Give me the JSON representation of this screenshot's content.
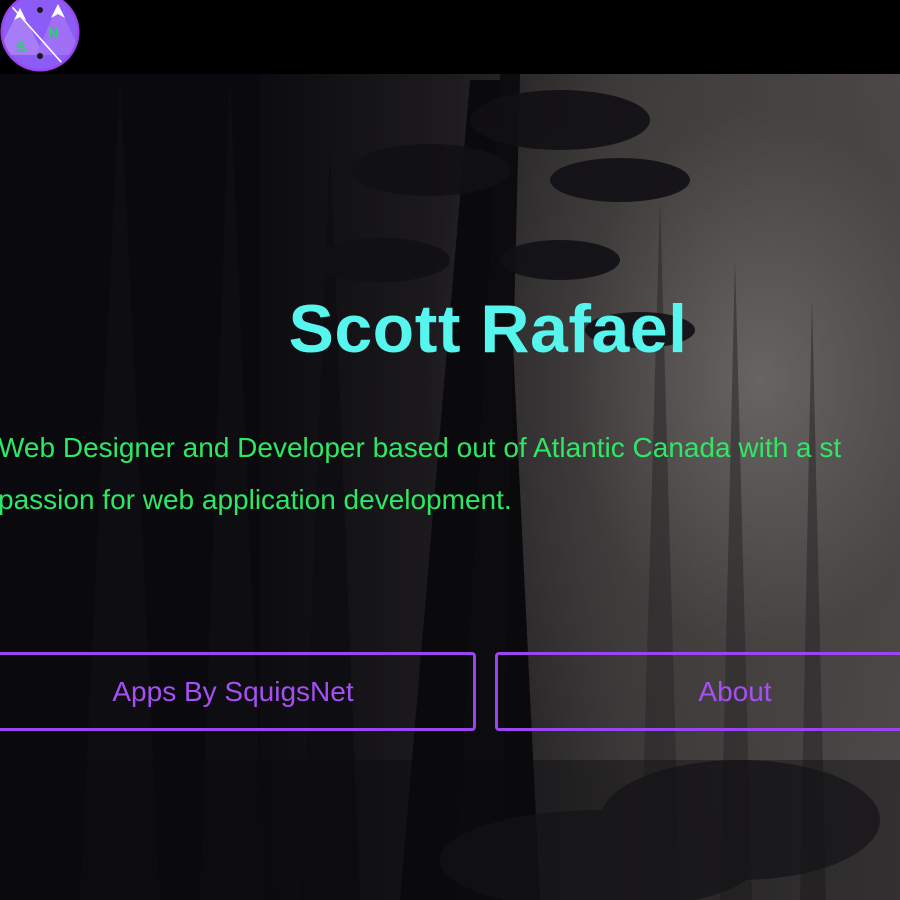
{
  "header": {
    "logo": {
      "icon": "sn-mountain-logo-icon",
      "letters": [
        "S",
        "N"
      ],
      "colors": {
        "ring": "#9b45f2",
        "mountain": "#ffffff",
        "letters": "#22d46a",
        "sky": "#7a49e8"
      }
    }
  },
  "hero": {
    "title": "Scott Rafael",
    "tagline_line1": "Web Designer and Developer based out of Atlantic Canada with a st",
    "tagline_line2": "passion for web application development."
  },
  "buttons": {
    "apps_label": "Apps By SquigsNet",
    "about_label": "About"
  },
  "colors": {
    "title": "#56f6ee",
    "tagline": "#2ee864",
    "button_border": "#9b45f2",
    "button_text": "#a64ff5",
    "topbar": "#000000"
  }
}
